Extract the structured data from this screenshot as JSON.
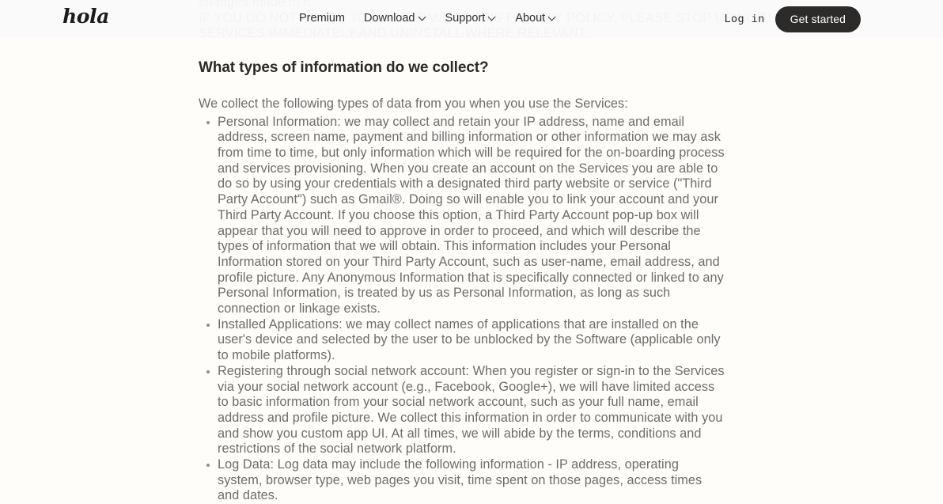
{
  "background_text": {
    "lines": [
      "changes made to it.",
      "IF YOU DO NOT AGREE TO THE TERMS OF THIS PRIVACY POLICY, PLEASE STOP USING THE",
      "SERVICES IMMEDIATELY AND UNINSTALL WHERE RELEVANT."
    ]
  },
  "header": {
    "logo": "hola",
    "nav": [
      {
        "label": "Premium",
        "has_chevron": false
      },
      {
        "label": "Download",
        "has_chevron": true
      },
      {
        "label": "Support",
        "has_chevron": true
      },
      {
        "label": "About",
        "has_chevron": true
      }
    ],
    "login_label": "Log in",
    "cta_label": "Get started",
    "cta_color": "#2d2b29",
    "bar_color": "#f8f9fb"
  },
  "page": {
    "background_color": "#fffdfa",
    "body_text_color": "#6d6d6d",
    "heading_color": "#2b2a28"
  },
  "content": {
    "heading": "What types of information do we collect?",
    "intro": "We collect the following types of data from you when you use the Services:",
    "bullets": [
      "Personal Information: we may collect and retain your IP address, name and email address, screen name, payment and billing information or other information we may ask from time to time, but only information which will be required for the on-boarding process and services provisioning. When you create an account on the Services you are able to do so by using your credentials with a designated third party website or service (\"Third Party Account\") such as Gmail®. Doing so will enable you to link your account and your Third Party Account. If you choose this option, a Third Party Account pop-up box will appear that you will need to approve in order to proceed, and which will describe the types of information that we will obtain. This information includes your Personal Information stored on your Third Party Account, such as user-name, email address, and profile picture. Any Anonymous Information that is specifically connected or linked to any Personal Information, is treated by us as Personal Information, as long as such connection or linkage exists.",
      "Installed Applications: we may collect names of applications that are installed on the user's device and selected by the user to be unblocked by the Software (applicable only to mobile platforms).",
      "Registering through social network account: When you register or sign-in to the Services via your social network account (e.g., Facebook, Google+), we will have limited access to basic information from your social network account, such as your full name, email address and profile picture. We collect this information in order to communicate with you and show you custom app UI. At all times, we will abide by the terms, conditions and restrictions of the social network platform.",
      "Log Data: Log data may include the following information - IP address, operating system, browser type, web pages you visit, time spent on those pages, access times and dates."
    ]
  }
}
